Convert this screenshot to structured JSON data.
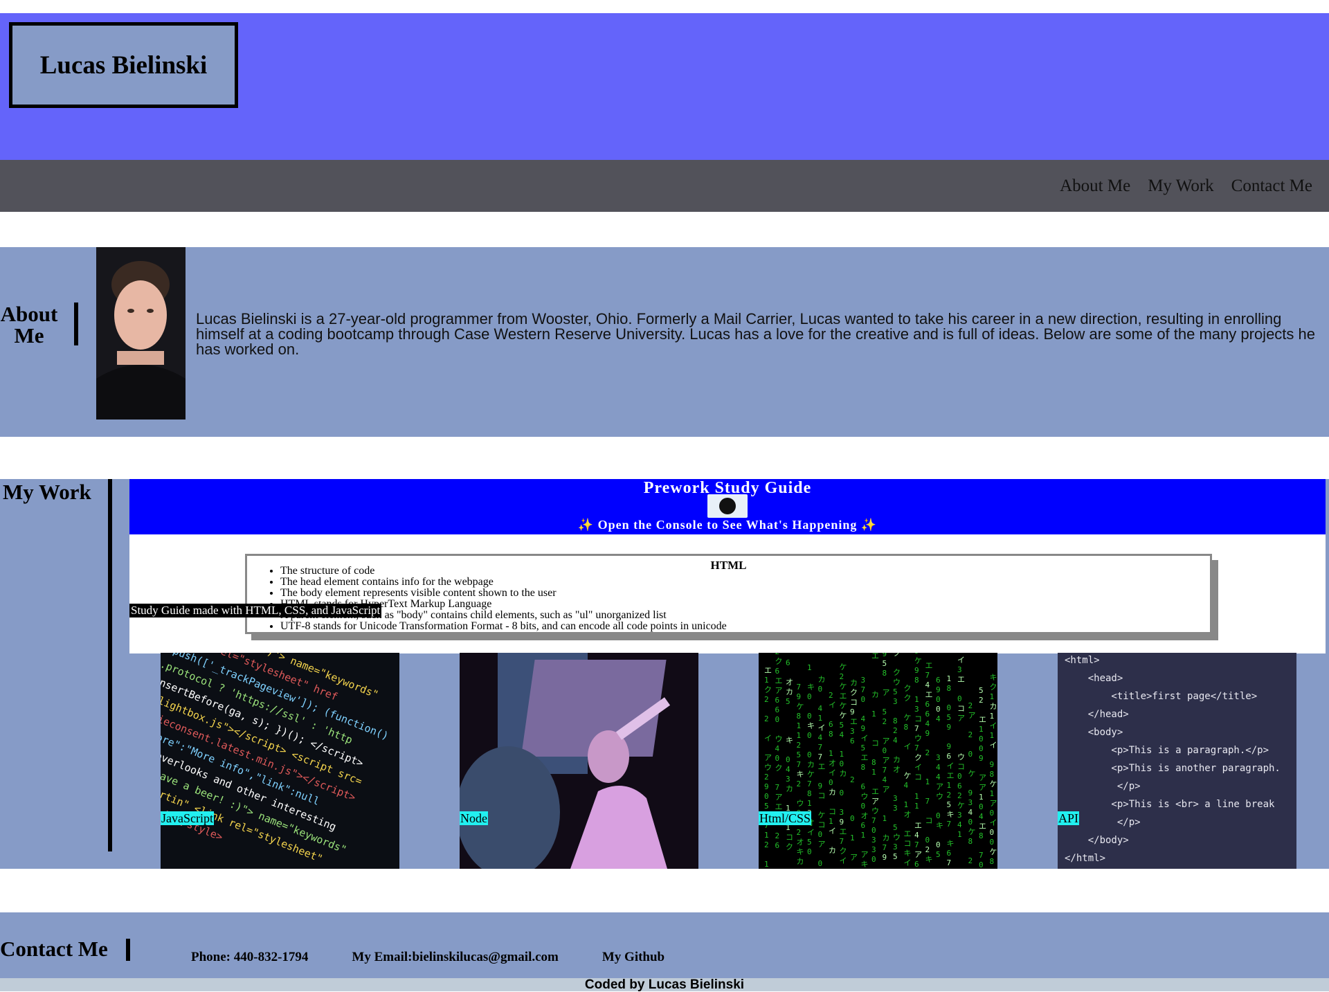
{
  "header": {
    "name": "Lucas Bielinski"
  },
  "nav": {
    "items": [
      "About Me",
      "My Work",
      "Contact Me"
    ]
  },
  "about": {
    "title": "About Me",
    "text": "Lucas Bielinski is a 27-year-old programmer from Wooster, Ohio. Formerly a Mail Carrier, Lucas wanted to take his career in a new direction, resulting in enrolling himself at a coding bootcamp through Case Western Reserve University. Lucas has a love for the creative and is full of ideas. Below are some of the many projects he has worked on."
  },
  "work": {
    "title": "My Work",
    "guide": {
      "title": "Prework Study Guide",
      "subtitle": "Open the Console to See What's Happening",
      "card_title": "HTML",
      "items": [
        "The structure of code",
        "The head element contains info for the webpage",
        "The body element represents visible content shown to the user",
        "HTML stands for HyperText Markup Language",
        "A parent element, such as \"body\" contains child elements, such as \"ul\" unorganized list",
        "UTF-8 stands for Unicode Transformation Format - 8 bits, and can encode all code points in unicode"
      ],
      "caption": "Study Guide made with HTML, CSS, and JavaScript"
    },
    "projects": [
      "JavaScript",
      "Node",
      "Html/CSS",
      "API"
    ],
    "code_snippet": [
      "<html>",
      "    <head>",
      "        <title>first page</title>",
      "    </head>",
      "    <body>",
      "        <p>This is a paragraph.</p>",
      "        <p>This is another paragraph.",
      "         </p>",
      "        <p>This is <br> a line break",
      "         </p>",
      "    </body>",
      "</html>"
    ]
  },
  "contact": {
    "title": "Contact Me",
    "phone": "Phone: 440-832-1794",
    "email": "My Email:bielinskilucas@gmail.com",
    "github": "My Github"
  },
  "footer": {
    "text": "Coded by Lucas Bielinski"
  },
  "colors": {
    "header": "#6464fa",
    "nav": "#52525a",
    "section": "#869bc7",
    "guide_header": "#0000ff",
    "label": "#22f0f0"
  }
}
